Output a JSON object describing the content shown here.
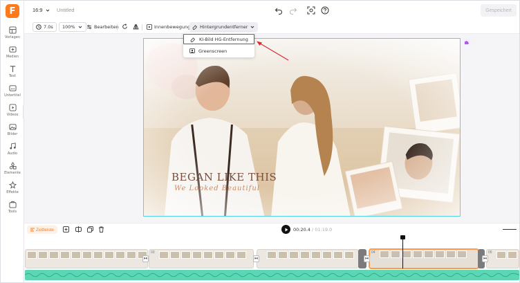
{
  "app": {
    "logo_letter": "F",
    "brand_color": "#ff7a1a"
  },
  "sidebar": {
    "items": [
      {
        "label": "Vorlagen",
        "icon": "template-icon"
      },
      {
        "label": "Medien",
        "icon": "media-icon"
      },
      {
        "label": "Text",
        "icon": "text-icon"
      },
      {
        "label": "Untertitel",
        "icon": "subtitle-icon"
      },
      {
        "label": "Videos",
        "icon": "video-icon"
      },
      {
        "label": "Bilder",
        "icon": "image-icon"
      },
      {
        "label": "Audio",
        "icon": "audio-icon"
      },
      {
        "label": "Elemente",
        "icon": "elements-icon"
      },
      {
        "label": "Effekte",
        "icon": "effects-icon"
      },
      {
        "label": "Tools",
        "icon": "tools-icon"
      }
    ]
  },
  "topbar": {
    "ratio": "16:9",
    "title": "Untitled",
    "save_label": "Gespeichert"
  },
  "toolbar": {
    "duration": "7.0s",
    "zoom": "100%",
    "edit_label": "Bearbeiten",
    "motion_label": "Innenbewegung",
    "bg_remover_label": "Hintergrundentferner"
  },
  "dropdown": {
    "items": [
      {
        "label": "KI-Bild HG-Entfernung",
        "highlighted": true
      },
      {
        "label": "Greenscreen",
        "highlighted": false
      }
    ]
  },
  "canvas": {
    "headline": "BEGAN LIKE THIS",
    "script_text": "We Looked Beautiful"
  },
  "timeline": {
    "label": "Zeitleiste",
    "current_time": "00:20.4",
    "total_time": "/ 01:19.0",
    "clip_numbers": [
      "03",
      "04",
      "05"
    ],
    "transition_icon": "⏵⏴"
  },
  "colors": {
    "selection": "#4fd4e8",
    "highlight": "#e0282e",
    "audio": "#5cd6b4",
    "selected_clip": "#ff9b4a"
  }
}
